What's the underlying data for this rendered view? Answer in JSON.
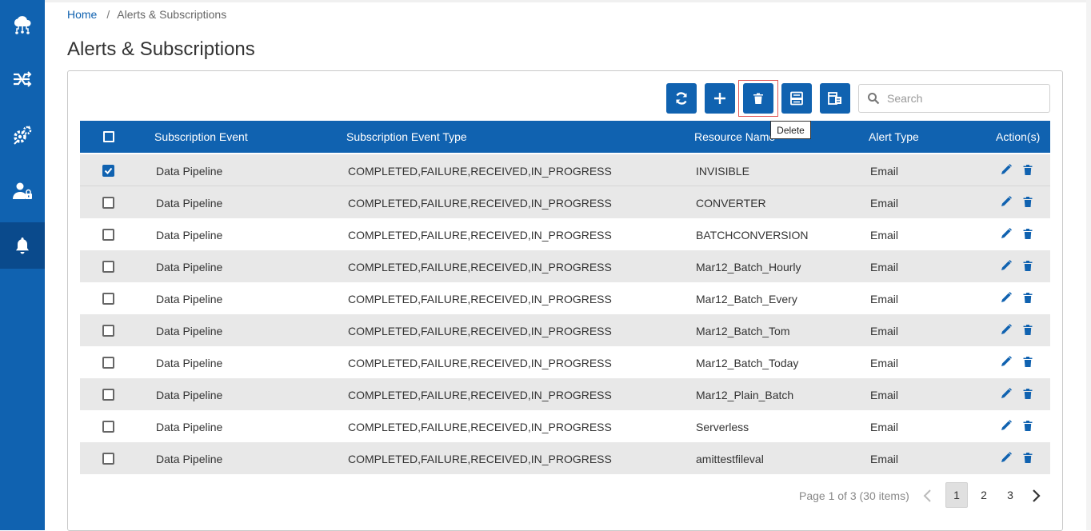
{
  "breadcrumb": {
    "home": "Home",
    "separator": "/",
    "current": "Alerts & Subscriptions"
  },
  "page": {
    "title": "Alerts & Subscriptions"
  },
  "toolbar": {
    "buttons": [
      "refresh-icon",
      "add-icon",
      "delete-icon",
      "export-xlsx-icon",
      "column-chooser-icon"
    ],
    "tooltip": "Delete"
  },
  "search": {
    "placeholder": "Search",
    "value": ""
  },
  "table": {
    "headers": {
      "event": "Subscription Event",
      "event_type": "Subscription Event Type",
      "resource": "Resource Name",
      "alert": "Alert Type",
      "actions": "Action(s)"
    },
    "rows": [
      {
        "checked": true,
        "event": "Data Pipeline",
        "event_type": "COMPLETED,FAILURE,RECEIVED,IN_PROGRESS",
        "resource": "INVISIBLE",
        "alert": "Email"
      },
      {
        "checked": false,
        "event": "Data Pipeline",
        "event_type": "COMPLETED,FAILURE,RECEIVED,IN_PROGRESS",
        "resource": "CONVERTER",
        "alert": "Email"
      },
      {
        "checked": false,
        "event": "Data Pipeline",
        "event_type": "COMPLETED,FAILURE,RECEIVED,IN_PROGRESS",
        "resource": "BATCHCONVERSION",
        "alert": "Email"
      },
      {
        "checked": false,
        "event": "Data Pipeline",
        "event_type": "COMPLETED,FAILURE,RECEIVED,IN_PROGRESS",
        "resource": "Mar12_Batch_Hourly",
        "alert": "Email"
      },
      {
        "checked": false,
        "event": "Data Pipeline",
        "event_type": "COMPLETED,FAILURE,RECEIVED,IN_PROGRESS",
        "resource": "Mar12_Batch_Every",
        "alert": "Email"
      },
      {
        "checked": false,
        "event": "Data Pipeline",
        "event_type": "COMPLETED,FAILURE,RECEIVED,IN_PROGRESS",
        "resource": "Mar12_Batch_Tom",
        "alert": "Email"
      },
      {
        "checked": false,
        "event": "Data Pipeline",
        "event_type": "COMPLETED,FAILURE,RECEIVED,IN_PROGRESS",
        "resource": "Mar12_Batch_Today",
        "alert": "Email"
      },
      {
        "checked": false,
        "event": "Data Pipeline",
        "event_type": "COMPLETED,FAILURE,RECEIVED,IN_PROGRESS",
        "resource": "Mar12_Plain_Batch",
        "alert": "Email"
      },
      {
        "checked": false,
        "event": "Data Pipeline",
        "event_type": "COMPLETED,FAILURE,RECEIVED,IN_PROGRESS",
        "resource": "Serverless",
        "alert": "Email"
      },
      {
        "checked": false,
        "event": "Data Pipeline",
        "event_type": "COMPLETED,FAILURE,RECEIVED,IN_PROGRESS",
        "resource": "amittestfileval",
        "alert": "Email"
      }
    ]
  },
  "pager": {
    "info": "Page 1 of 3 (30 items)",
    "pages": [
      "1",
      "2",
      "3"
    ],
    "current": "1"
  },
  "sidebar": {
    "items": [
      "cloud-network-icon",
      "pipeline-shuffle-icon",
      "settings-gears-icon",
      "user-lock-icon",
      "bell-icon"
    ],
    "active": "bell-icon"
  },
  "colors": {
    "primary": "#1062b0",
    "sidebar_active": "#0a4a8c",
    "row_alt": "#e8e8e8",
    "highlight": "#e05555"
  }
}
